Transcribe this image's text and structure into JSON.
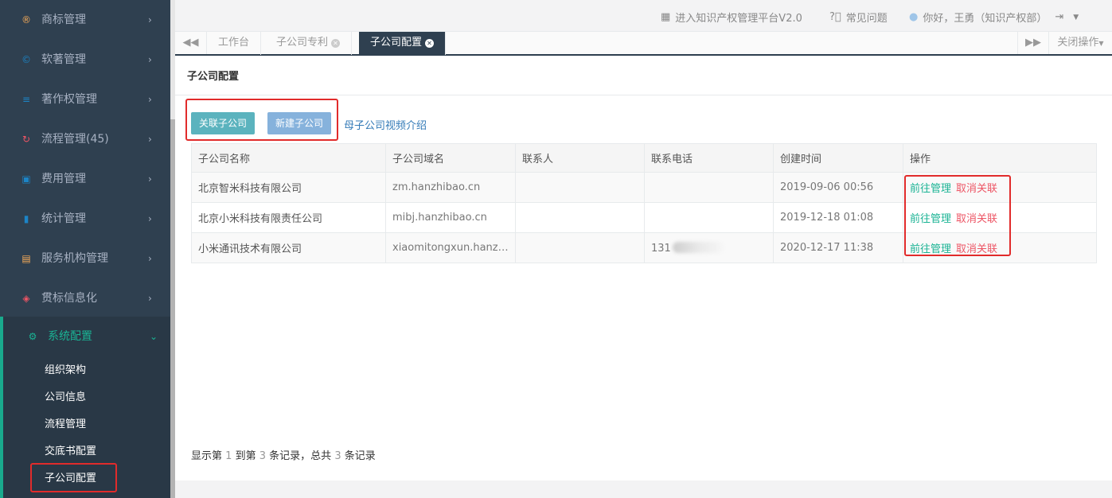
{
  "sidebar": {
    "items": [
      {
        "label": "商标管理",
        "icon": "trademark-icon",
        "color": "#f8ac59",
        "glyph": "®"
      },
      {
        "label": "软著管理",
        "icon": "copyright-icon",
        "color": "#1c84c6",
        "glyph": "©"
      },
      {
        "label": "著作权管理",
        "icon": "layers-icon",
        "color": "#1c84c6",
        "glyph": "≡"
      },
      {
        "label": "流程管理(45)",
        "icon": "process-icon",
        "color": "#ed5565",
        "glyph": "↻"
      },
      {
        "label": "费用管理",
        "icon": "wallet-icon",
        "color": "#1c84c6",
        "glyph": "▣"
      },
      {
        "label": "统计管理",
        "icon": "bar-chart-icon",
        "color": "#1c84c6",
        "glyph": "▮"
      },
      {
        "label": "服务机构管理",
        "icon": "building-icon",
        "color": "#f8ac59",
        "glyph": "▤"
      },
      {
        "label": "贯标信息化",
        "icon": "shield-icon",
        "color": "#ed5565",
        "glyph": "◈"
      }
    ],
    "active": {
      "label": "系统配置",
      "icon": "gear-icon",
      "glyph": "⚙"
    },
    "submenu": [
      "组织架构",
      "公司信息",
      "流程管理",
      "交底书配置",
      "子公司配置"
    ]
  },
  "topbar": {
    "platform_link": "进入知识产权管理平台V2.0",
    "faq_link": "常见问题",
    "greeting": "你好，王勇（知识产权部）"
  },
  "tabs": {
    "items": [
      {
        "label": "工作台",
        "closable": false
      },
      {
        "label": "子公司专利",
        "closable": true
      },
      {
        "label": "子公司配置",
        "closable": true,
        "active": true
      }
    ],
    "close_ops": "关闭操作"
  },
  "main": {
    "title": "子公司配置",
    "link_button": "关联子公司",
    "new_button": "新建子公司",
    "video_link": "母子公司视频介绍",
    "table": {
      "headers": [
        "子公司名称",
        "子公司域名",
        "联系人",
        "联系电话",
        "创建时间",
        "操作"
      ],
      "rows": [
        {
          "name": "北京智米科技有限公司",
          "domain": "zm.hanzhibao.cn",
          "contact": "",
          "phone": "",
          "created": "2019-09-06 00:56"
        },
        {
          "name": "北京小米科技有限责任公司",
          "domain": "mibj.hanzhibao.cn",
          "contact": "",
          "phone": "",
          "created": "2019-12-18 01:08"
        },
        {
          "name": "小米通讯技术有限公司",
          "domain": "xiaomitongxun.hanzhi...",
          "contact": "",
          "phone": "131",
          "created": "2020-12-17 11:38"
        }
      ],
      "op_manage": "前往管理",
      "op_cancel": "取消关联"
    },
    "pager": {
      "p1": "显示第",
      "from": "1",
      "p2": "到第",
      "to": "3",
      "p3": "条记录，总共",
      "total": "3",
      "p4": "条记录"
    }
  },
  "colors": {
    "sidebar_bg": "#2f4050",
    "accent": "#1ab394",
    "danger": "#ed5565",
    "highlight_box": "#e12b2b"
  }
}
